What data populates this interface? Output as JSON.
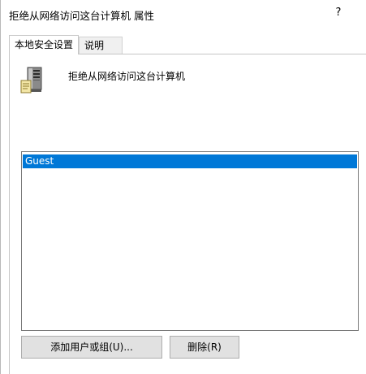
{
  "window": {
    "title": "拒绝从网络访问这台计算机 属性",
    "help_label": "?"
  },
  "tabs": [
    {
      "label": "本地安全设置",
      "active": true
    },
    {
      "label": "说明",
      "active": false
    }
  ],
  "policy": {
    "name": "拒绝从网络访问这台计算机",
    "icon": "server-policy-icon"
  },
  "accounts": {
    "items": [
      "Guest"
    ],
    "selected_index": 0,
    "selection_color": "#0078d7"
  },
  "buttons": {
    "add_label": "添加用户或组(U)...",
    "remove_label": "删除(R)"
  }
}
